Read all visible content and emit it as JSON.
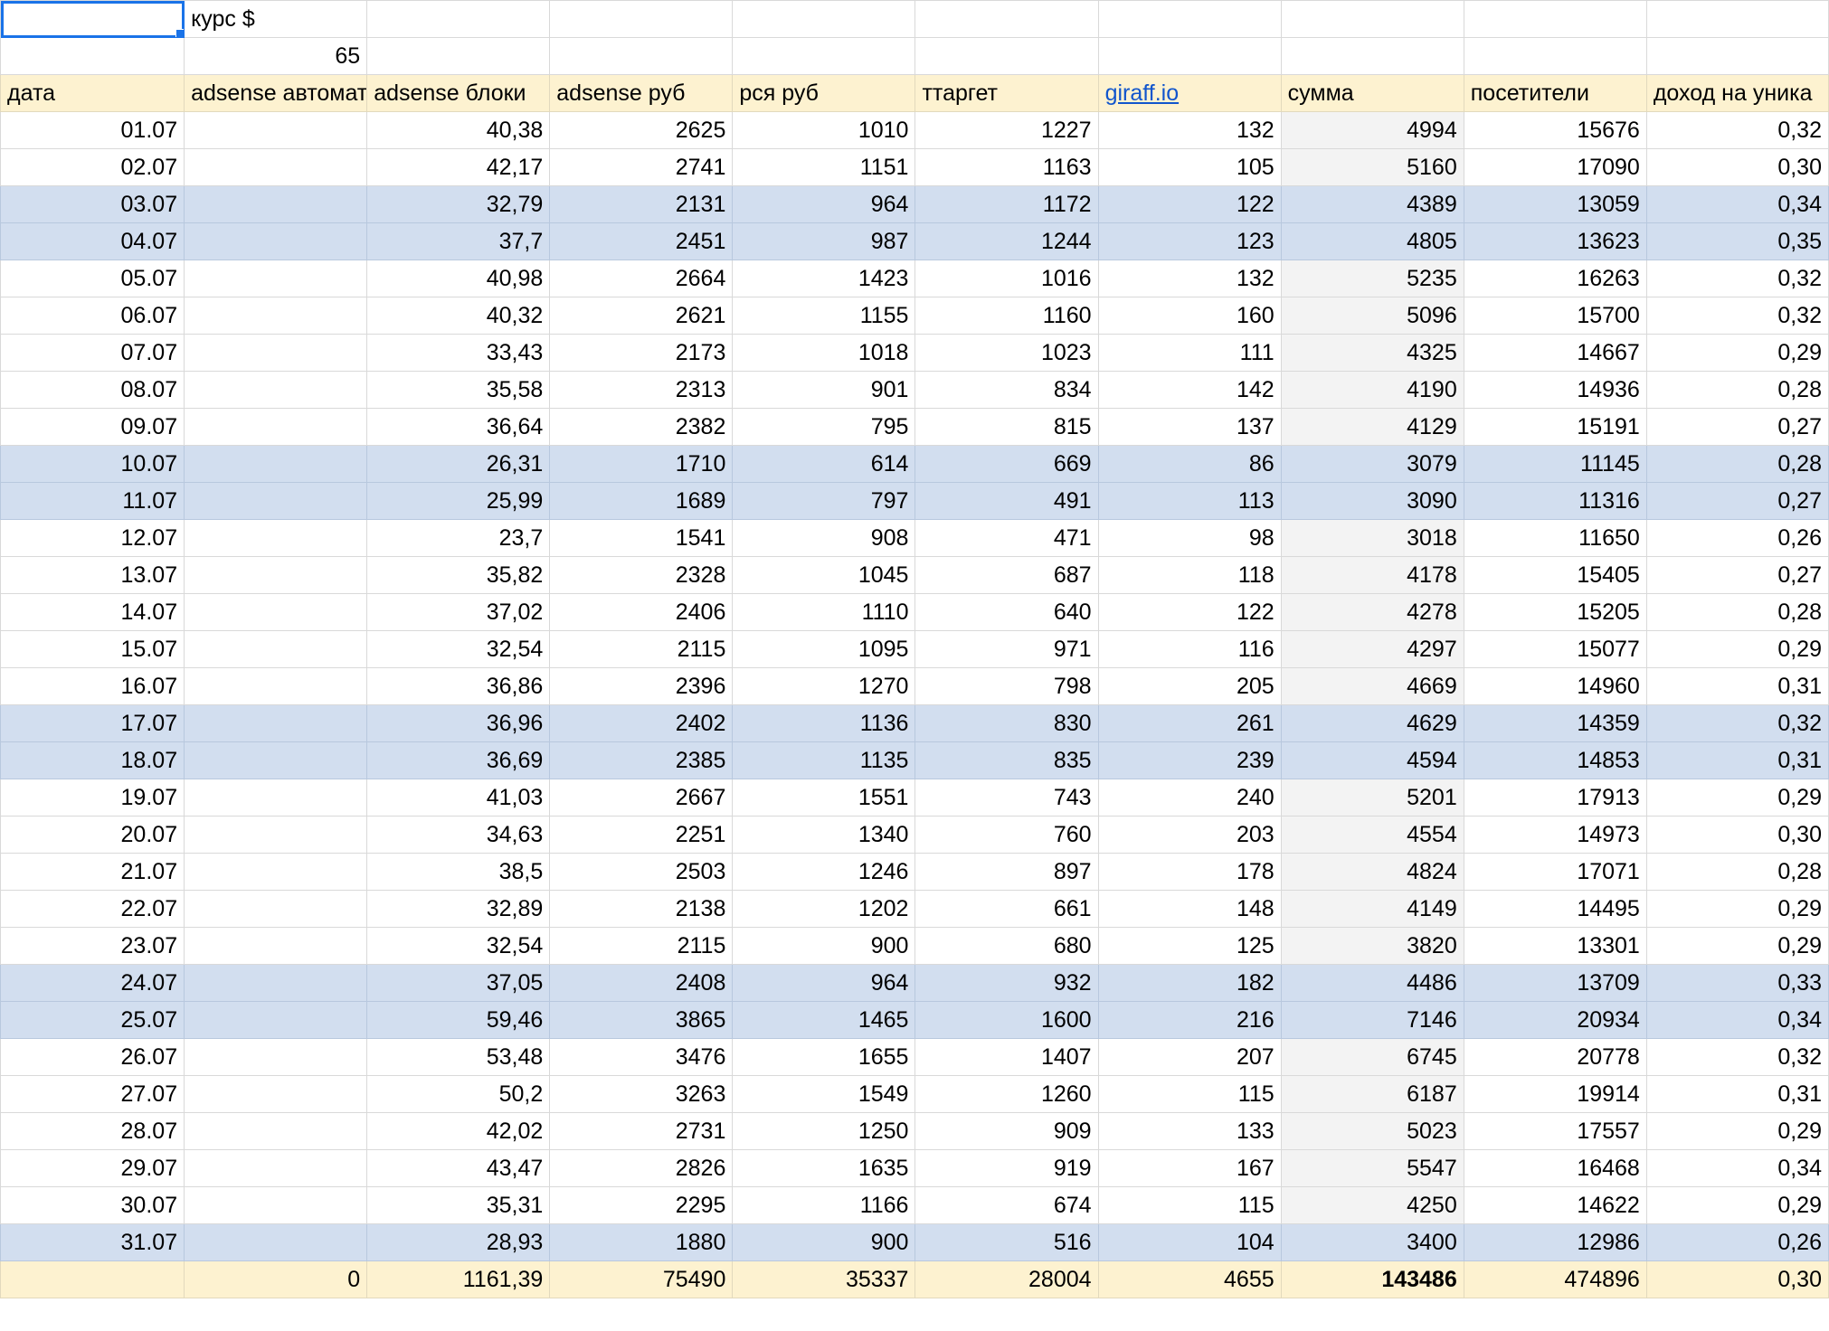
{
  "top": {
    "rate_label": "курс $",
    "rate_value": "65"
  },
  "headers": [
    "дата",
    "adsense автомат",
    "adsense блоки",
    "adsense руб",
    "рся руб",
    "ттаргет",
    "giraff.io",
    "сумма",
    "посетители",
    "доход на уника"
  ],
  "rows": [
    {
      "d": "01.07",
      "a": "",
      "b": "40,38",
      "r": "2625",
      "y": "1010",
      "t": "1227",
      "g": "132",
      "s": "4994",
      "p": "15676",
      "u": "0,32",
      "weekend": false
    },
    {
      "d": "02.07",
      "a": "",
      "b": "42,17",
      "r": "2741",
      "y": "1151",
      "t": "1163",
      "g": "105",
      "s": "5160",
      "p": "17090",
      "u": "0,30",
      "weekend": false
    },
    {
      "d": "03.07",
      "a": "",
      "b": "32,79",
      "r": "2131",
      "y": "964",
      "t": "1172",
      "g": "122",
      "s": "4389",
      "p": "13059",
      "u": "0,34",
      "weekend": true
    },
    {
      "d": "04.07",
      "a": "",
      "b": "37,7",
      "r": "2451",
      "y": "987",
      "t": "1244",
      "g": "123",
      "s": "4805",
      "p": "13623",
      "u": "0,35",
      "weekend": true
    },
    {
      "d": "05.07",
      "a": "",
      "b": "40,98",
      "r": "2664",
      "y": "1423",
      "t": "1016",
      "g": "132",
      "s": "5235",
      "p": "16263",
      "u": "0,32",
      "weekend": false
    },
    {
      "d": "06.07",
      "a": "",
      "b": "40,32",
      "r": "2621",
      "y": "1155",
      "t": "1160",
      "g": "160",
      "s": "5096",
      "p": "15700",
      "u": "0,32",
      "weekend": false
    },
    {
      "d": "07.07",
      "a": "",
      "b": "33,43",
      "r": "2173",
      "y": "1018",
      "t": "1023",
      "g": "111",
      "s": "4325",
      "p": "14667",
      "u": "0,29",
      "weekend": false
    },
    {
      "d": "08.07",
      "a": "",
      "b": "35,58",
      "r": "2313",
      "y": "901",
      "t": "834",
      "g": "142",
      "s": "4190",
      "p": "14936",
      "u": "0,28",
      "weekend": false
    },
    {
      "d": "09.07",
      "a": "",
      "b": "36,64",
      "r": "2382",
      "y": "795",
      "t": "815",
      "g": "137",
      "s": "4129",
      "p": "15191",
      "u": "0,27",
      "weekend": false
    },
    {
      "d": "10.07",
      "a": "",
      "b": "26,31",
      "r": "1710",
      "y": "614",
      "t": "669",
      "g": "86",
      "s": "3079",
      "p": "11145",
      "u": "0,28",
      "weekend": true
    },
    {
      "d": "11.07",
      "a": "",
      "b": "25,99",
      "r": "1689",
      "y": "797",
      "t": "491",
      "g": "113",
      "s": "3090",
      "p": "11316",
      "u": "0,27",
      "weekend": true
    },
    {
      "d": "12.07",
      "a": "",
      "b": "23,7",
      "r": "1541",
      "y": "908",
      "t": "471",
      "g": "98",
      "s": "3018",
      "p": "11650",
      "u": "0,26",
      "weekend": false
    },
    {
      "d": "13.07",
      "a": "",
      "b": "35,82",
      "r": "2328",
      "y": "1045",
      "t": "687",
      "g": "118",
      "s": "4178",
      "p": "15405",
      "u": "0,27",
      "weekend": false
    },
    {
      "d": "14.07",
      "a": "",
      "b": "37,02",
      "r": "2406",
      "y": "1110",
      "t": "640",
      "g": "122",
      "s": "4278",
      "p": "15205",
      "u": "0,28",
      "weekend": false
    },
    {
      "d": "15.07",
      "a": "",
      "b": "32,54",
      "r": "2115",
      "y": "1095",
      "t": "971",
      "g": "116",
      "s": "4297",
      "p": "15077",
      "u": "0,29",
      "weekend": false
    },
    {
      "d": "16.07",
      "a": "",
      "b": "36,86",
      "r": "2396",
      "y": "1270",
      "t": "798",
      "g": "205",
      "s": "4669",
      "p": "14960",
      "u": "0,31",
      "weekend": false
    },
    {
      "d": "17.07",
      "a": "",
      "b": "36,96",
      "r": "2402",
      "y": "1136",
      "t": "830",
      "g": "261",
      "s": "4629",
      "p": "14359",
      "u": "0,32",
      "weekend": true
    },
    {
      "d": "18.07",
      "a": "",
      "b": "36,69",
      "r": "2385",
      "y": "1135",
      "t": "835",
      "g": "239",
      "s": "4594",
      "p": "14853",
      "u": "0,31",
      "weekend": true
    },
    {
      "d": "19.07",
      "a": "",
      "b": "41,03",
      "r": "2667",
      "y": "1551",
      "t": "743",
      "g": "240",
      "s": "5201",
      "p": "17913",
      "u": "0,29",
      "weekend": false
    },
    {
      "d": "20.07",
      "a": "",
      "b": "34,63",
      "r": "2251",
      "y": "1340",
      "t": "760",
      "g": "203",
      "s": "4554",
      "p": "14973",
      "u": "0,30",
      "weekend": false
    },
    {
      "d": "21.07",
      "a": "",
      "b": "38,5",
      "r": "2503",
      "y": "1246",
      "t": "897",
      "g": "178",
      "s": "4824",
      "p": "17071",
      "u": "0,28",
      "weekend": false
    },
    {
      "d": "22.07",
      "a": "",
      "b": "32,89",
      "r": "2138",
      "y": "1202",
      "t": "661",
      "g": "148",
      "s": "4149",
      "p": "14495",
      "u": "0,29",
      "weekend": false
    },
    {
      "d": "23.07",
      "a": "",
      "b": "32,54",
      "r": "2115",
      "y": "900",
      "t": "680",
      "g": "125",
      "s": "3820",
      "p": "13301",
      "u": "0,29",
      "weekend": false
    },
    {
      "d": "24.07",
      "a": "",
      "b": "37,05",
      "r": "2408",
      "y": "964",
      "t": "932",
      "g": "182",
      "s": "4486",
      "p": "13709",
      "u": "0,33",
      "weekend": true
    },
    {
      "d": "25.07",
      "a": "",
      "b": "59,46",
      "r": "3865",
      "y": "1465",
      "t": "1600",
      "g": "216",
      "s": "7146",
      "p": "20934",
      "u": "0,34",
      "weekend": true
    },
    {
      "d": "26.07",
      "a": "",
      "b": "53,48",
      "r": "3476",
      "y": "1655",
      "t": "1407",
      "g": "207",
      "s": "6745",
      "p": "20778",
      "u": "0,32",
      "weekend": false
    },
    {
      "d": "27.07",
      "a": "",
      "b": "50,2",
      "r": "3263",
      "y": "1549",
      "t": "1260",
      "g": "115",
      "s": "6187",
      "p": "19914",
      "u": "0,31",
      "weekend": false
    },
    {
      "d": "28.07",
      "a": "",
      "b": "42,02",
      "r": "2731",
      "y": "1250",
      "t": "909",
      "g": "133",
      "s": "5023",
      "p": "17557",
      "u": "0,29",
      "weekend": false
    },
    {
      "d": "29.07",
      "a": "",
      "b": "43,47",
      "r": "2826",
      "y": "1635",
      "t": "919",
      "g": "167",
      "s": "5547",
      "p": "16468",
      "u": "0,34",
      "weekend": false
    },
    {
      "d": "30.07",
      "a": "",
      "b": "35,31",
      "r": "2295",
      "y": "1166",
      "t": "674",
      "g": "115",
      "s": "4250",
      "p": "14622",
      "u": "0,29",
      "weekend": false
    },
    {
      "d": "31.07",
      "a": "",
      "b": "28,93",
      "r": "1880",
      "y": "900",
      "t": "516",
      "g": "104",
      "s": "3400",
      "p": "12986",
      "u": "0,26",
      "weekend": true
    }
  ],
  "totals": {
    "d": "",
    "a": "0",
    "b": "1161,39",
    "r": "75490",
    "y": "35337",
    "t": "28004",
    "g": "4655",
    "s": "143486",
    "p": "474896",
    "u": "0,30"
  },
  "colors": {
    "header_bg": "#fdf2d0",
    "weekend_bg": "#d2deef",
    "sum_col_bg": "#f3f3f3",
    "link": "#1155cc",
    "selection": "#1a73e8"
  }
}
